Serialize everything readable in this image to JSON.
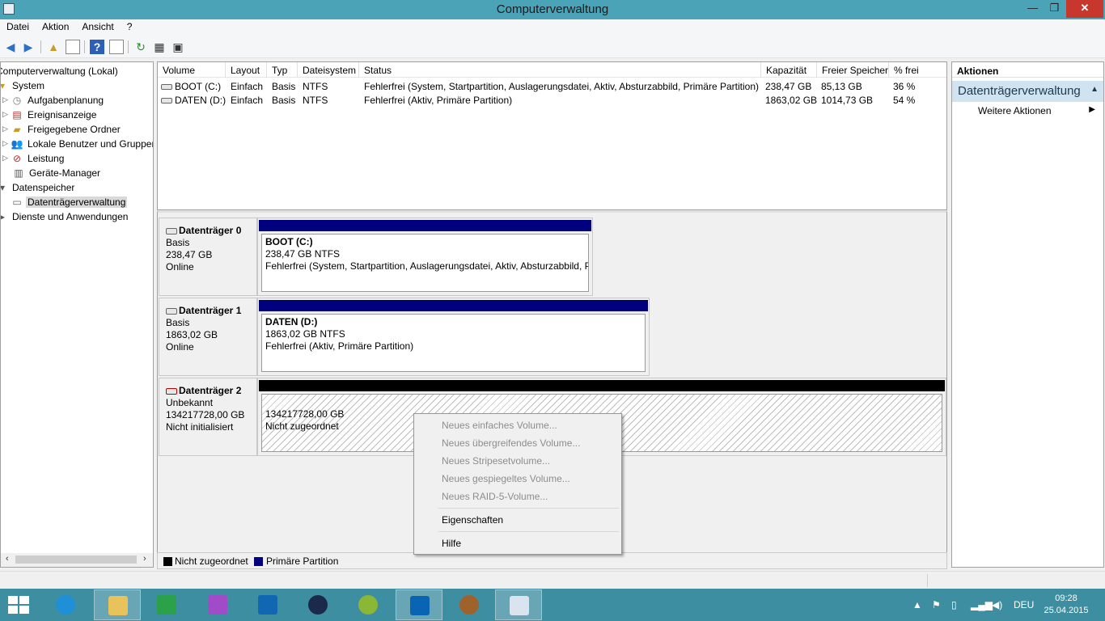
{
  "window": {
    "title": "Computerverwaltung",
    "minimize": "—",
    "maximize": "❐",
    "close": "✕"
  },
  "menu": [
    "Datei",
    "Aktion",
    "Ansicht",
    "?"
  ],
  "tree": {
    "root": "Computerverwaltung (Lokal)",
    "items": [
      {
        "label": "System",
        "icon": "computer-management-icon"
      },
      {
        "label": "Aufgabenplanung",
        "icon": "clock-icon"
      },
      {
        "label": "Ereignisanzeige",
        "icon": "event-viewer-icon"
      },
      {
        "label": "Freigegebene Ordner",
        "icon": "shared-folder-icon"
      },
      {
        "label": "Lokale Benutzer und Gruppen",
        "icon": "users-icon"
      },
      {
        "label": "Leistung",
        "icon": "performance-icon"
      },
      {
        "label": "Geräte-Manager",
        "icon": "device-manager-icon"
      },
      {
        "label": "Datenspeicher",
        "icon": "storage-icon"
      },
      {
        "label": "Datenträgerverwaltung",
        "icon": "disk-management-icon"
      },
      {
        "label": "Dienste und Anwendungen",
        "icon": "services-icon"
      }
    ]
  },
  "volumes": {
    "headers": [
      "Volume",
      "Layout",
      "Typ",
      "Dateisystem",
      "Status",
      "Kapazität",
      "Freier Speicher",
      "% frei"
    ],
    "rows": [
      [
        "BOOT (C:)",
        "Einfach",
        "Basis",
        "NTFS",
        "Fehlerfrei (System, Startpartition, Auslagerungsdatei, Aktiv, Absturzabbild, Primäre Partition)",
        "238,47 GB",
        "85,13 GB",
        "36 %"
      ],
      [
        "DATEN (D:)",
        "Einfach",
        "Basis",
        "NTFS",
        "Fehlerfrei (Aktiv, Primäre Partition)",
        "1863,02 GB",
        "1014,73 GB",
        "54 %"
      ]
    ]
  },
  "disks": [
    {
      "name": "Datenträger 0",
      "type": "Basis",
      "size": "238,47 GB",
      "state": "Online",
      "partition": {
        "title": "BOOT  (C:)",
        "line2": "238,47 GB NTFS",
        "line3": "Fehlerfrei (System, Startpartition, Auslagerungsdatei, Aktiv, Absturzabbild, Primäre Partition)",
        "bar_color": "#00007f"
      }
    },
    {
      "name": "Datenträger 1",
      "type": "Basis",
      "size": "1863,02 GB",
      "state": "Online",
      "partition": {
        "title": "DATEN  (D:)",
        "line2": "1863,02 GB NTFS",
        "line3": "Fehlerfrei (Aktiv, Primäre Partition)",
        "bar_color": "#00007f"
      }
    },
    {
      "name": "Datenträger 2",
      "type": "Unbekannt",
      "size": "134217728,00 GB",
      "state": "Nicht initialisiert",
      "partition": {
        "title": "",
        "line2": "134217728,00 GB",
        "line3": "Nicht zugeordnet",
        "bar_color": "#000000"
      }
    }
  ],
  "legend": [
    {
      "label": "Nicht zugeordnet",
      "color": "#000000"
    },
    {
      "label": "Primäre Partition",
      "color": "#00007f"
    }
  ],
  "actions": {
    "header": "Aktionen",
    "section": "Datenträgerverwaltung",
    "items": [
      "Weitere Aktionen"
    ]
  },
  "context_menu": {
    "disabled_items": [
      "Neues einfaches Volume...",
      "Neues übergreifendes Volume...",
      "Neues Stripesetvolume...",
      "Neues gespiegeltes Volume...",
      "Neues RAID-5-Volume..."
    ],
    "properties": "Eigenschaften",
    "help": "Hilfe"
  },
  "taskbar": {
    "apps": [
      "internet-explorer-icon",
      "file-explorer-icon",
      "store-icon",
      "onenote-icon",
      "messaging-icon",
      "keepass-icon",
      "qgis-icon",
      "outlook-icon",
      "moose-app-icon",
      "computer-management-icon"
    ],
    "language": "DEU",
    "time": "09:28",
    "date": "25.04.2015"
  }
}
